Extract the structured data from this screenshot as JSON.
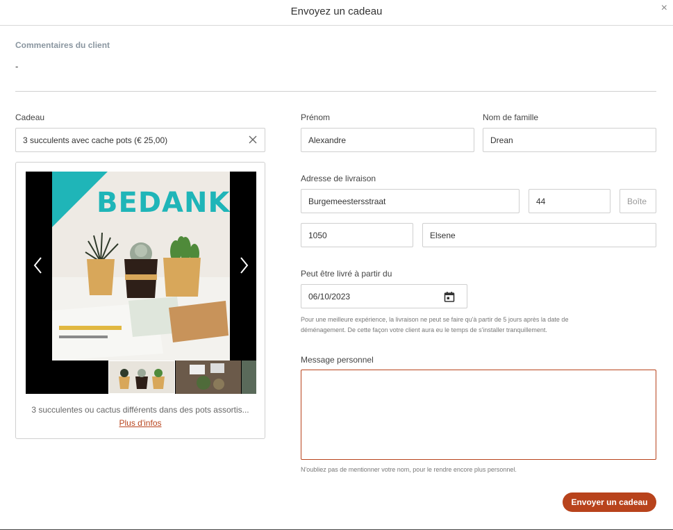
{
  "header": {
    "title": "Envoyez un cadeau",
    "close_symbol": "×"
  },
  "comments": {
    "label": "Commentaires du client",
    "value": "-"
  },
  "gift": {
    "label": "Cadeau",
    "selected": "3 succulents avec cache pots (€ 25,00)",
    "photo_text": "BEDANKT!",
    "caption": "3 succulentes ou cactus différents dans des pots assortis...",
    "more_link": "Plus d'infos"
  },
  "form": {
    "first_name_label": "Prénom",
    "first_name": "Alexandre",
    "last_name_label": "Nom de famille",
    "last_name": "Drean",
    "address_label": "Adresse de livraison",
    "street": "Burgemeestersstraat",
    "number": "44",
    "box_placeholder": "Boîte",
    "postal_code": "1050",
    "city": "Elsene",
    "date_label": "Peut être livré à partir du",
    "date": "06/10/2023",
    "date_help_1": "Pour une meilleure expérience, la livraison ne peut se faire qu'à partir de 5 jours après la date de",
    "date_help_2": "déménagement. De cette façon votre client aura eu le temps de s'installer tranquillement.",
    "message_label": "Message personnel",
    "message": "",
    "message_help": "N'oubliez pas de mentionner votre nom, pour le rendre encore plus personnel.",
    "submit": "Envoyer un cadeau"
  },
  "colors": {
    "accent": "#b8431c",
    "teal": "#1fb5b8"
  },
  "icons": {
    "close": "close-icon",
    "clear": "clear-icon",
    "prev": "chevron-left-icon",
    "next": "chevron-right-icon",
    "calendar": "calendar-icon"
  }
}
